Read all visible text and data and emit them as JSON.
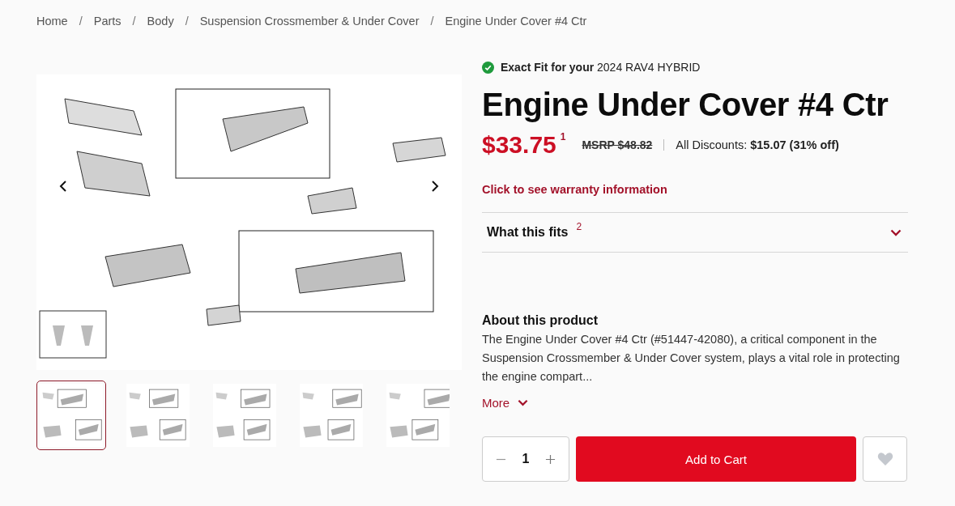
{
  "breadcrumb": {
    "items": [
      "Home",
      "Parts",
      "Body",
      "Suspension Crossmember & Under Cover",
      "Engine Under Cover #4 Ctr"
    ],
    "separators": [
      "/",
      "/",
      "/",
      "/"
    ]
  },
  "gallery": {
    "thumbnails": [
      {
        "selected": true
      },
      {
        "selected": false
      },
      {
        "selected": false
      },
      {
        "selected": false
      },
      {
        "selected": false
      }
    ]
  },
  "fit": {
    "prefix": "Exact Fit for your",
    "vehicle": "2024 RAV4 HYBRID"
  },
  "title": "Engine Under Cover #4 Ctr",
  "price": {
    "amount": "$33.75",
    "footnote": "1",
    "msrp": "MSRP $48.82",
    "discount_label": "All Discounts:",
    "discount_value": "$15.07 (31% off)"
  },
  "warranty_link": "Click to see warranty information",
  "fits_section": {
    "label": "What this fits",
    "footnote": "2",
    "expanded": false
  },
  "about": {
    "heading": "About this product",
    "text": "The Engine Under Cover #4 Ctr (#51447-42080), a critical component in the Suspension Crossmember & Under Cover system, plays a vital role in protecting the engine compart...",
    "more_label": "More"
  },
  "cart": {
    "quantity": "1",
    "button": "Add to Cart"
  }
}
